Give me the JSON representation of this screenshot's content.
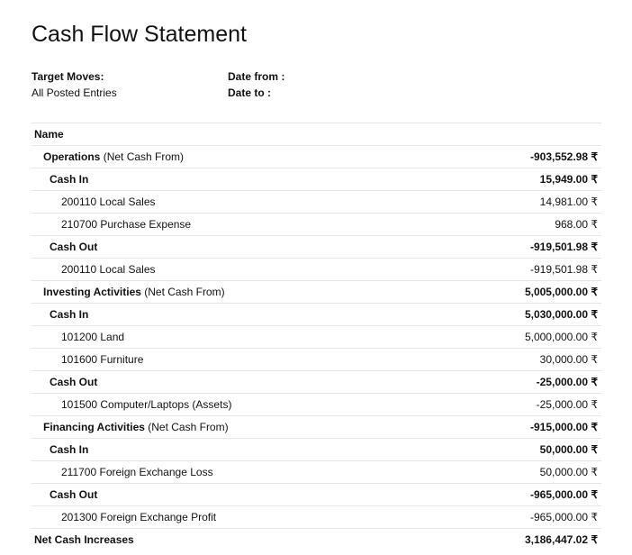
{
  "report": {
    "title": "Cash Flow Statement"
  },
  "filters": {
    "target_moves_label": "Target Moves:",
    "target_moves_value": "All Posted Entries",
    "date_from_label": "Date from :",
    "date_to_label": "Date to :"
  },
  "table": {
    "header": "Name",
    "rows": [
      {
        "level": 1,
        "name_bold": "Operations",
        "name_rest": " (Net Cash From)",
        "amount": "-903,552.98 ₹"
      },
      {
        "level": 2,
        "name_bold": "Cash In",
        "name_rest": "",
        "amount": "15,949.00 ₹"
      },
      {
        "level": 3,
        "name_bold": "",
        "name_rest": "200110 Local Sales",
        "amount": "14,981.00 ₹"
      },
      {
        "level": 3,
        "name_bold": "",
        "name_rest": "210700 Purchase Expense",
        "amount": "968.00 ₹"
      },
      {
        "level": 2,
        "name_bold": "Cash Out",
        "name_rest": "",
        "amount": "-919,501.98 ₹"
      },
      {
        "level": 3,
        "name_bold": "",
        "name_rest": "200110 Local Sales",
        "amount": "-919,501.98 ₹"
      },
      {
        "level": 1,
        "name_bold": "Investing Activities",
        "name_rest": " (Net Cash From)",
        "amount": "5,005,000.00 ₹"
      },
      {
        "level": 2,
        "name_bold": "Cash In",
        "name_rest": "",
        "amount": "5,030,000.00 ₹"
      },
      {
        "level": 3,
        "name_bold": "",
        "name_rest": "101200 Land",
        "amount": "5,000,000.00 ₹"
      },
      {
        "level": 3,
        "name_bold": "",
        "name_rest": "101600 Furniture",
        "amount": "30,000.00 ₹"
      },
      {
        "level": 2,
        "name_bold": "Cash Out",
        "name_rest": "",
        "amount": "-25,000.00 ₹"
      },
      {
        "level": 3,
        "name_bold": "",
        "name_rest": "101500 Computer/Laptops (Assets)",
        "amount": "-25,000.00 ₹"
      },
      {
        "level": 1,
        "name_bold": "Financing Activities",
        "name_rest": " (Net Cash From)",
        "amount": "-915,000.00 ₹"
      },
      {
        "level": 2,
        "name_bold": "Cash In",
        "name_rest": "",
        "amount": "50,000.00 ₹"
      },
      {
        "level": 3,
        "name_bold": "",
        "name_rest": "211700 Foreign Exchange Loss",
        "amount": "50,000.00 ₹"
      },
      {
        "level": 2,
        "name_bold": "Cash Out",
        "name_rest": "",
        "amount": "-965,000.00 ₹"
      },
      {
        "level": 3,
        "name_bold": "",
        "name_rest": "201300 Foreign Exchange Profit",
        "amount": "-965,000.00 ₹"
      },
      {
        "level": "total",
        "name_bold": "Net Cash Increases",
        "name_rest": "",
        "amount": "3,186,447.02 ₹"
      }
    ]
  }
}
